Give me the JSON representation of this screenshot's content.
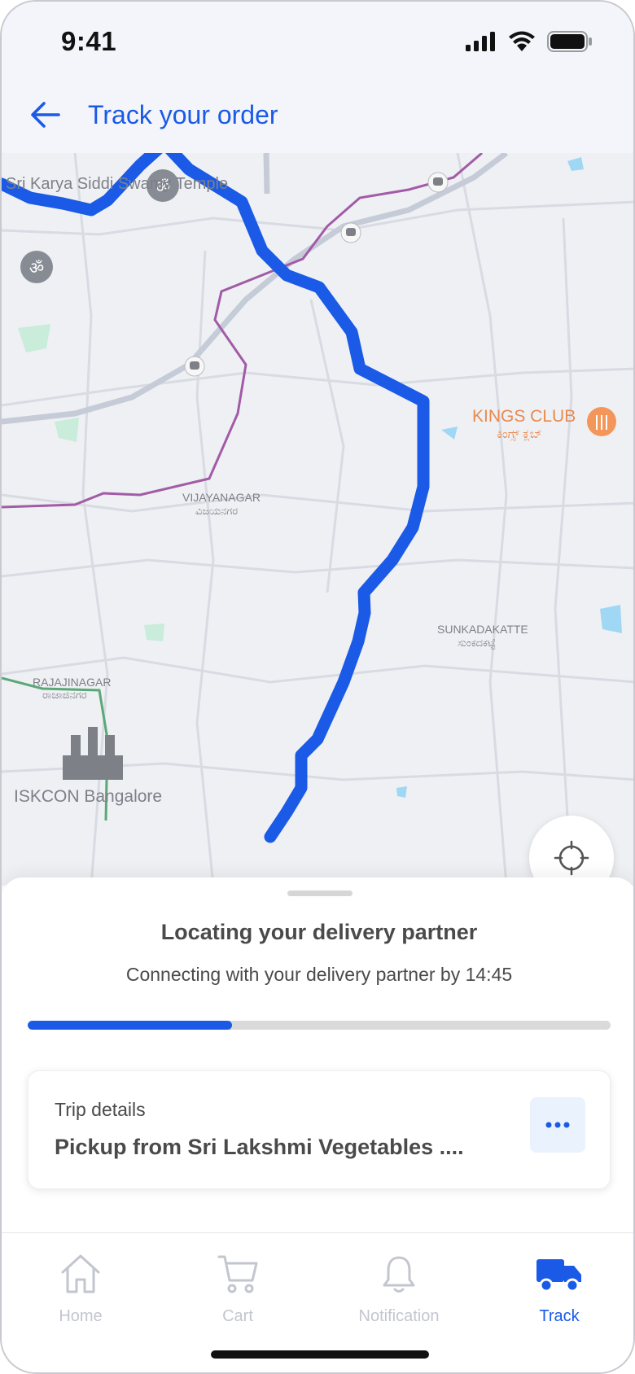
{
  "status_bar": {
    "time": "9:41"
  },
  "header": {
    "title": "Track your order"
  },
  "map": {
    "labels": {
      "temple": "Sri Karya Siddi Swamy Temple",
      "kings_club": "KINGS CLUB",
      "kings_club_local": "ಕಿಂಗ್ಸ್ ಕ್ಲಬ್",
      "vijayanagar": "VIJAYANAGAR",
      "vijayanagar_local": "ವಿಜಯನಗರ",
      "sunkadakatte": "SUNKADAKATTE",
      "sunkadakatte_local": "ಸುಂಕದಕಟ್ಟೆ",
      "rajajinagar": "RAJAJINAGAR",
      "rajajinagar_local": "ರಾಜಾಜಿನಗರ",
      "iskcon": "ISKCON Bangalore"
    },
    "route_color": "#1a5ae6"
  },
  "sheet": {
    "title": "Locating your delivery partner",
    "subtitle": "Connecting with your delivery partner by 14:45",
    "progress": 0.35,
    "trip_label": "Trip details",
    "trip_value": "Pickup from Sri Lakshmi Vegetables ...."
  },
  "tabs": [
    {
      "label": "Home",
      "icon": "home-icon",
      "active": false
    },
    {
      "label": "Cart",
      "icon": "cart-icon",
      "active": false
    },
    {
      "label": "Notification",
      "icon": "bell-icon",
      "active": false
    },
    {
      "label": "Track",
      "icon": "truck-icon",
      "active": true
    }
  ],
  "colors": {
    "accent": "#1a5ae6",
    "inactive": "#c3c6cf",
    "text": "#4a4a4a"
  }
}
